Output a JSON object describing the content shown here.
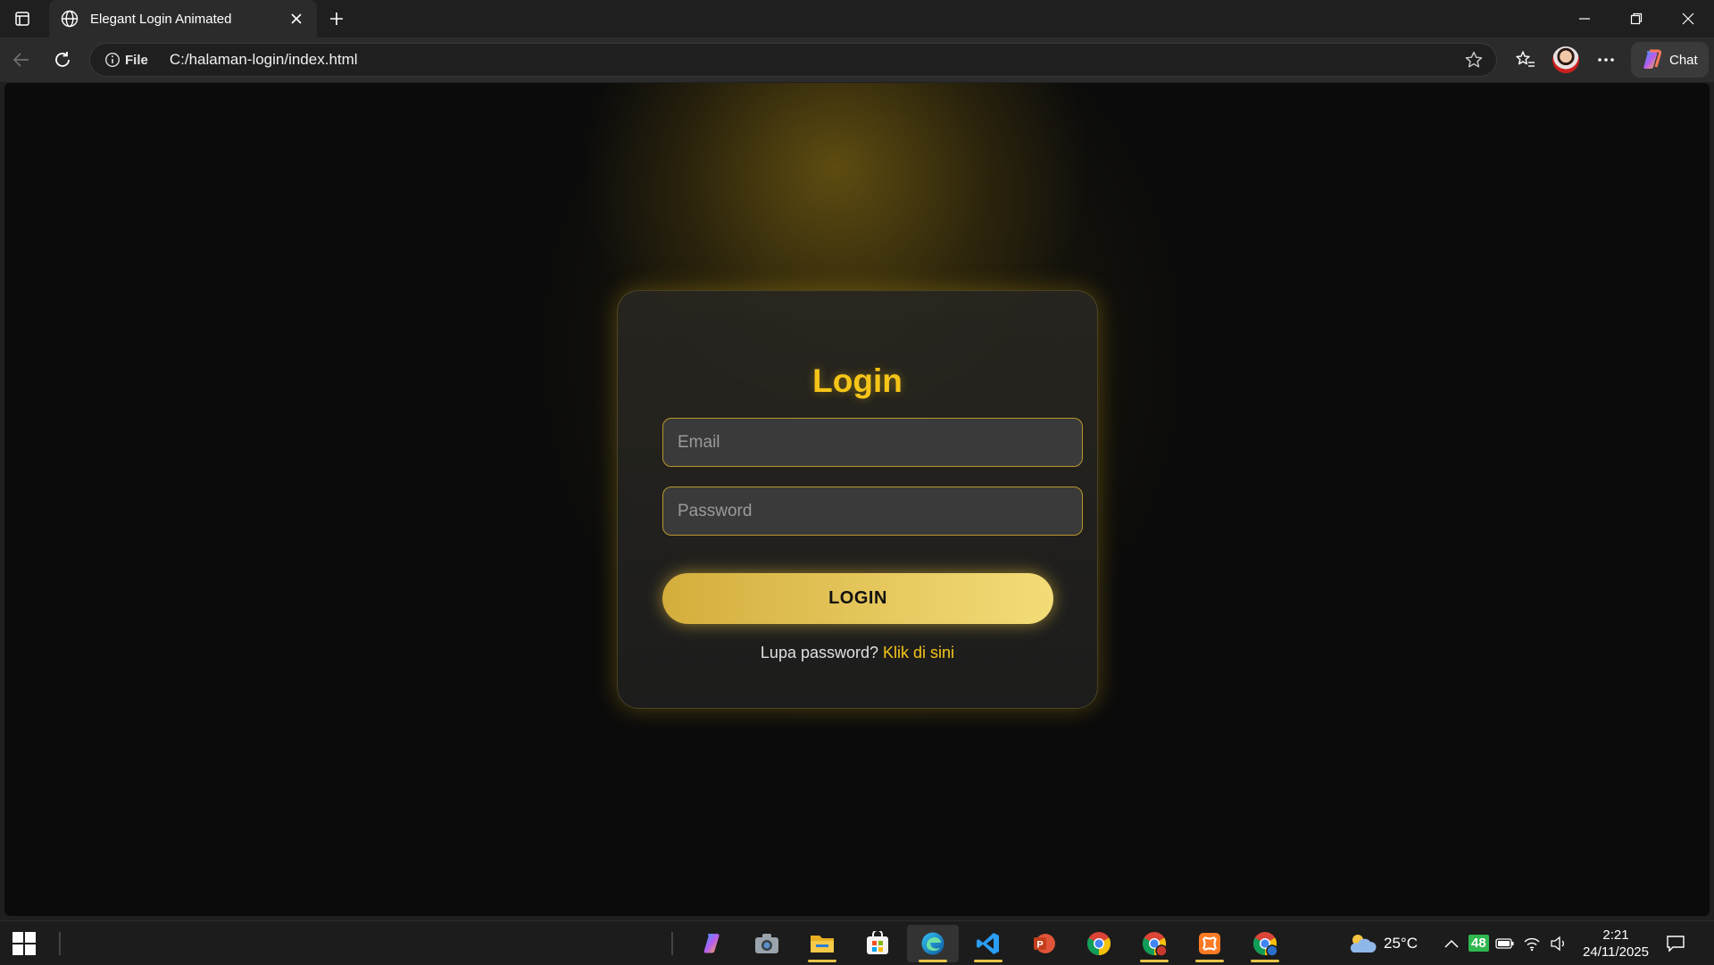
{
  "browser": {
    "tab_title": "Elegant Login Animated",
    "site_info_label": "File",
    "url": "C:/halaman-login/index.html",
    "chat_label": "Chat"
  },
  "login": {
    "title": "Login",
    "email_placeholder": "Email",
    "password_placeholder": "Password",
    "button_label": "LOGIN",
    "forgot_text": "Lupa password?",
    "forgot_link": "Klik di sini"
  },
  "taskbar": {
    "apps": [
      "copilot-icon",
      "camera-icon",
      "file-explorer-icon",
      "store-icon",
      "edge-icon",
      "vscode-icon",
      "powerpoint-icon",
      "chrome-icon",
      "chrome-profile-icon",
      "xampp-icon",
      "chrome-profile-2-icon"
    ],
    "weather": "25°C",
    "battery_badge": "48",
    "time": "2:21",
    "date": "24/11/2025"
  },
  "colors": {
    "accent_gold": "#f5c518",
    "button_gradient_start": "#d4ae3c",
    "button_gradient_end": "#f3dc78"
  }
}
